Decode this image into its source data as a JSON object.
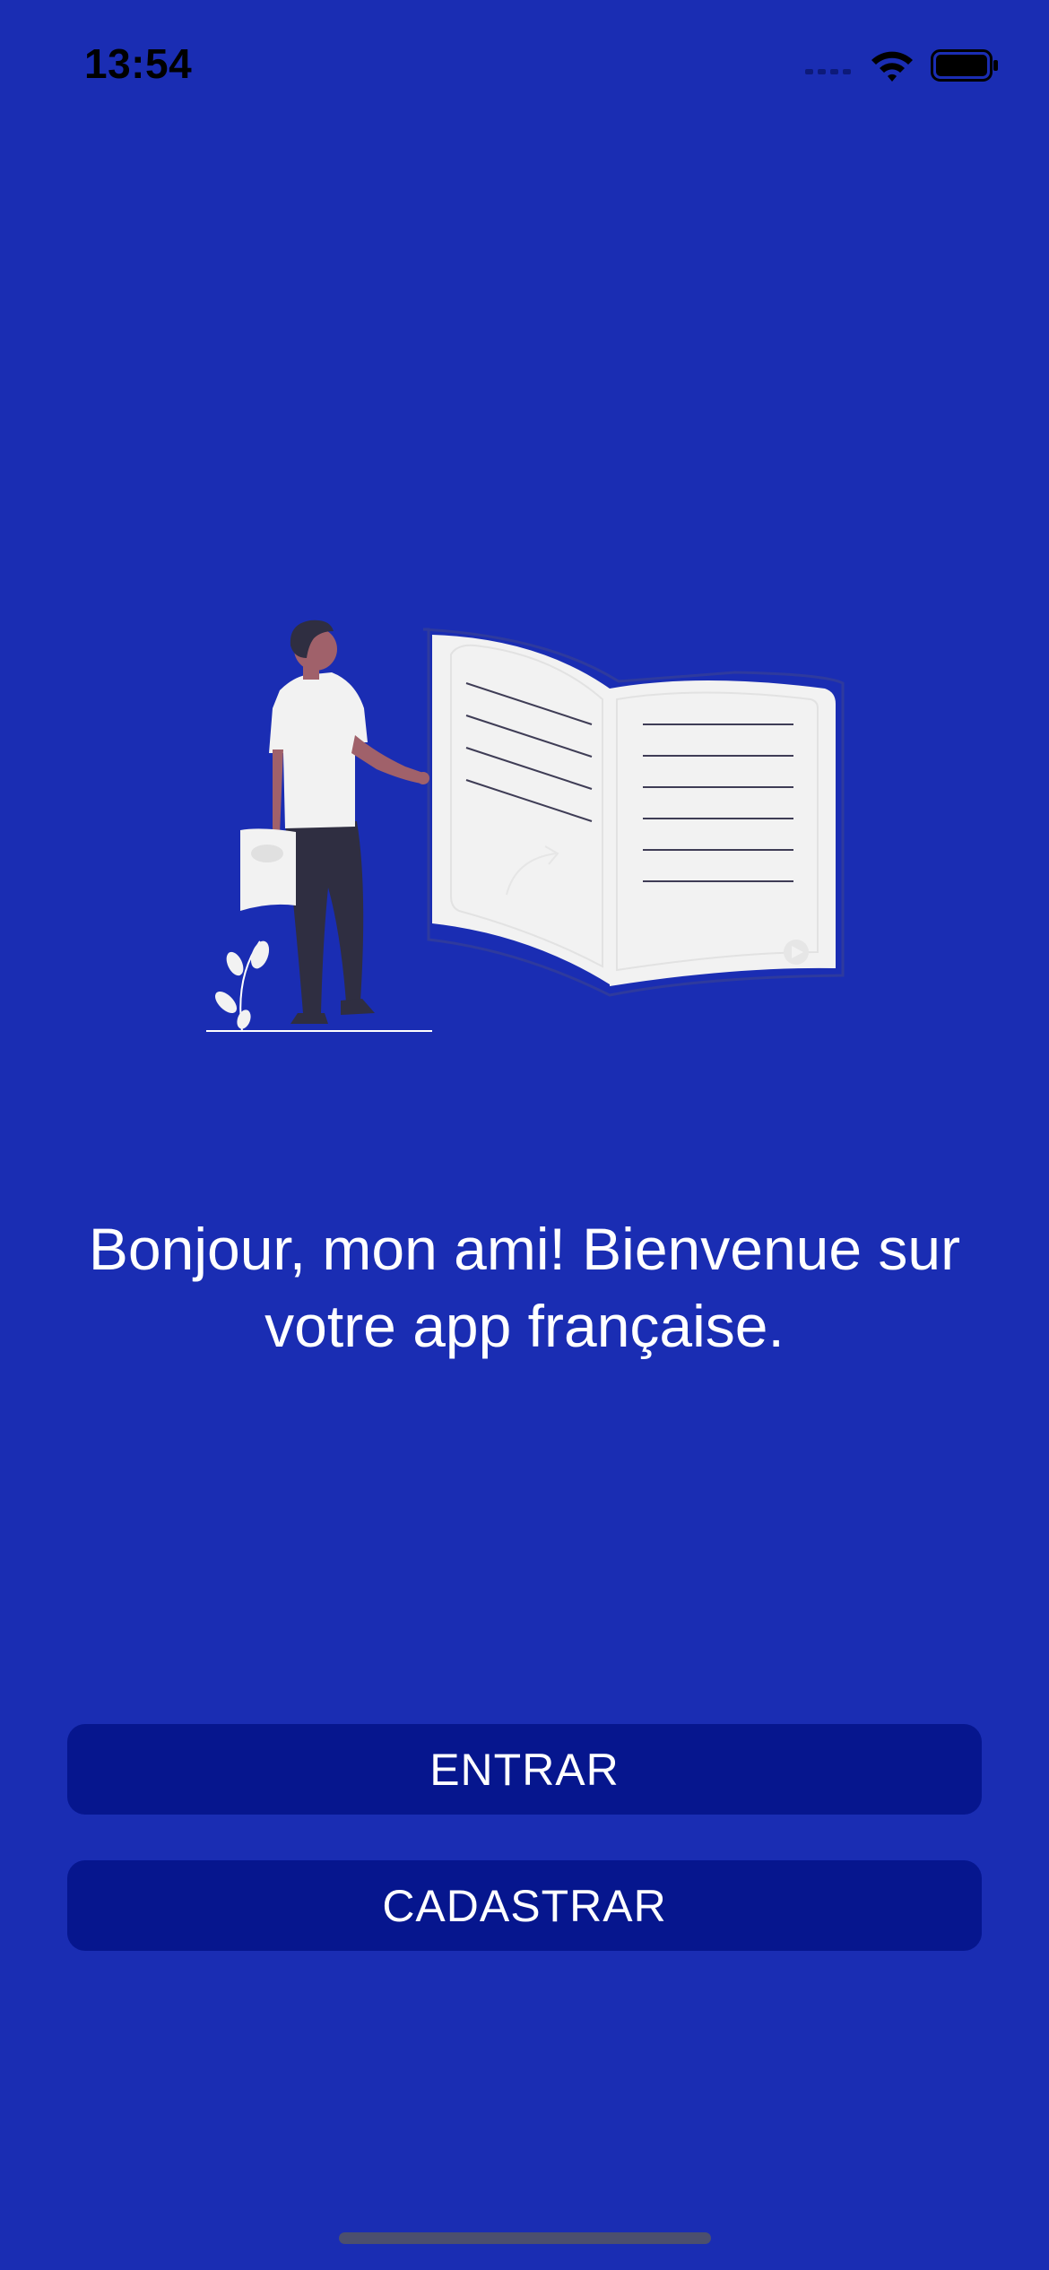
{
  "status_bar": {
    "time": "13:54",
    "icons": [
      "cellular-signal-icon",
      "wifi-icon",
      "battery-icon"
    ]
  },
  "illustration": {
    "name": "person-reading-book-illustration"
  },
  "welcome": {
    "text": "Bonjour, mon ami! Bienvenue sur votre app française."
  },
  "buttons": {
    "login_label": "ENTRAR",
    "signup_label": "CADASTRAR"
  },
  "colors": {
    "background": "#1a2db3",
    "button": "#06168e",
    "text": "#ffffff"
  }
}
